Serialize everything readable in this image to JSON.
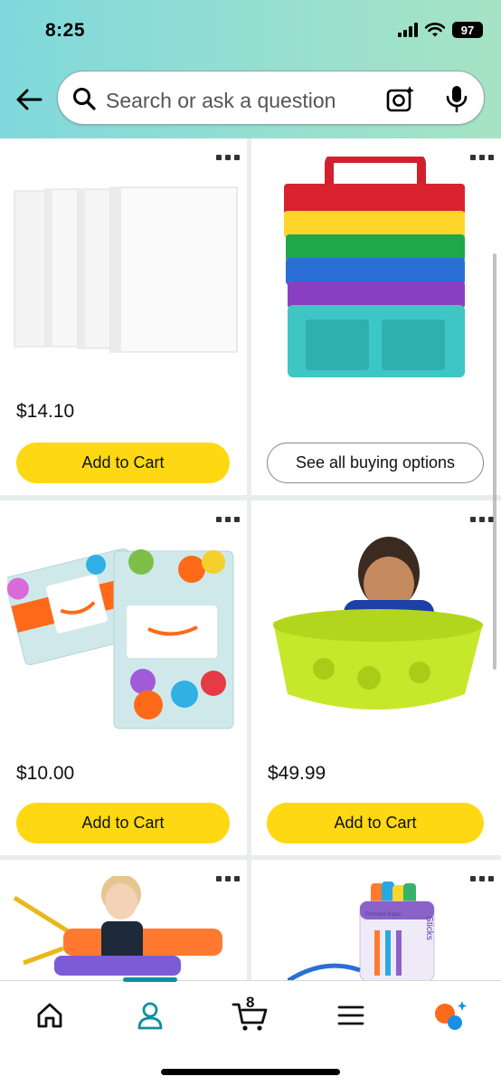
{
  "status_bar": {
    "time": "8:25",
    "battery": "97"
  },
  "search": {
    "placeholder": "Search or ask a question"
  },
  "products": [
    {
      "name": "binders",
      "price": "$14.10",
      "button": "Add to Cart"
    },
    {
      "name": "storage-caddies",
      "price": "",
      "button": "See all buying options"
    },
    {
      "name": "gift-cards",
      "price": "$10.00",
      "button": "Add to Cart"
    },
    {
      "name": "rocker-toy",
      "price": "$49.99",
      "button": "Add to Cart"
    },
    {
      "name": "scooter-board",
      "price": "",
      "button": ""
    },
    {
      "name": "sticks-jar",
      "price": "",
      "button": ""
    }
  ],
  "product_image_text": {
    "sticks": "Sticks",
    "brand": "Primitive Bidas"
  },
  "bottom_nav": {
    "items": [
      "home-icon",
      "account-icon",
      "cart-icon",
      "menu-icon",
      "ai-assistant-icon"
    ],
    "cart_count": "8",
    "active": "account"
  },
  "colors": {
    "header_gradient_start": "#80d8dc",
    "header_gradient_end": "#a6e3c4",
    "add_to_cart": "#ffd814",
    "active_tab": "#0c8f9f",
    "assistant_orange": "#ff6a1a",
    "assistant_blue": "#1a8fe3"
  }
}
